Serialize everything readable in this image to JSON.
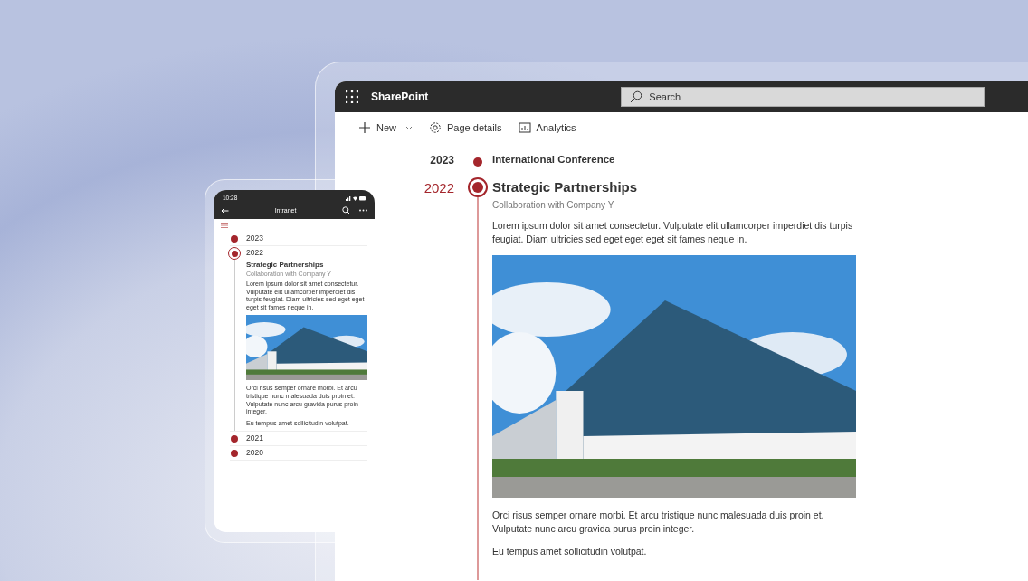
{
  "desktop": {
    "app_title": "SharePoint",
    "search": {
      "placeholder": "Search"
    },
    "toolbar": [
      {
        "label": "New",
        "dropdown": true
      },
      {
        "label": "Page details",
        "dropdown": false
      },
      {
        "label": "Analytics",
        "dropdown": false
      }
    ],
    "timeline": [
      {
        "year": "2023",
        "title": "International Conference",
        "expanded": false
      },
      {
        "year": "2022",
        "title": "Strategic Partnerships",
        "expanded": true,
        "subtitle": "Collaboration with Company Y",
        "paragraphs_before": [
          "Lorem ipsum dolor sit amet consectetur. Vulputate elit ullamcorper imperdiet dis turpis feugiat. Diam ultricies sed eget eget eget sit fames neque in."
        ],
        "paragraphs_after": [
          "Orci risus semper ornare morbi. Et arcu tristique nunc malesuada duis proin et. Vulputate nunc arcu gravida purus proin integer.",
          "Eu tempus amet sollicitudin volutpat."
        ]
      }
    ]
  },
  "phone": {
    "status_time": "10:28",
    "header_title": "Intranet",
    "timeline": [
      {
        "year": "2023",
        "expanded": false
      },
      {
        "year": "2022",
        "expanded": true,
        "title": "Strategic Partnerships",
        "subtitle": "Collaboration with Company Y",
        "paragraphs_before": [
          "Lorem ipsum dolor sit amet consectetur. Vulputate elit ullamcorper imperdiet dis turpis feugiat. Diam ultricies sed eget eget eget sit fames neque in."
        ],
        "paragraphs_after": [
          "Orci risus semper ornare morbi. Et arcu tristique nunc malesuada duis proin et. Vulputate nunc arcu gravida purus proin integer.",
          "Eu tempus amet sollicitudin volutpat."
        ]
      },
      {
        "year": "2021",
        "expanded": false
      },
      {
        "year": "2020",
        "expanded": false
      }
    ]
  }
}
